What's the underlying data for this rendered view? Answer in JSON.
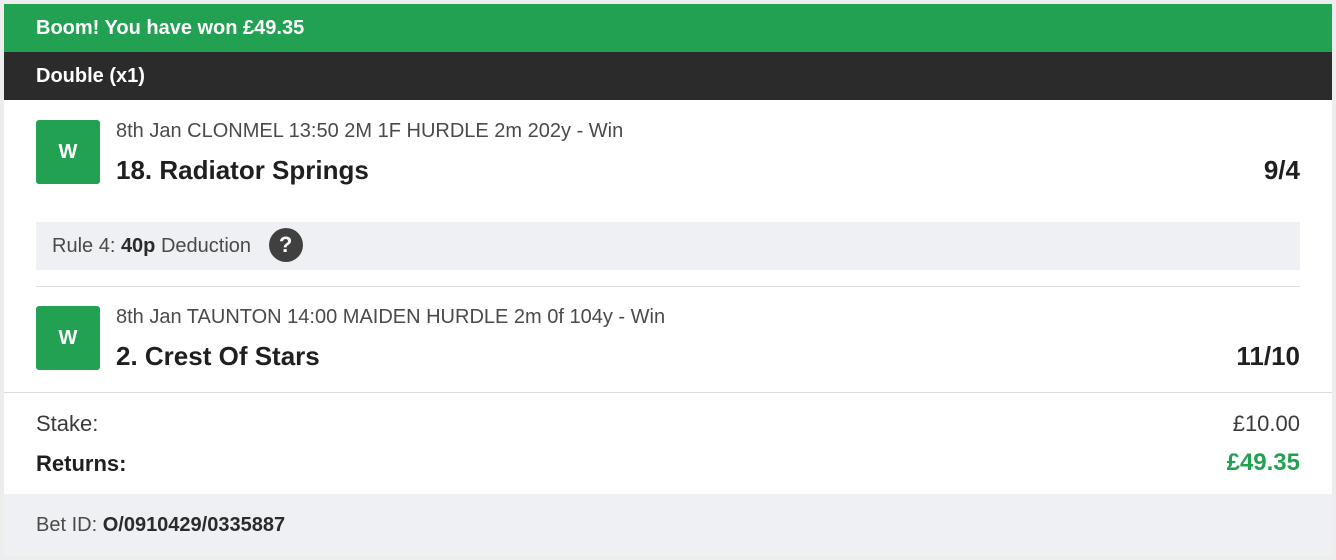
{
  "banner": {
    "message": "Boom! You have won £49.35"
  },
  "bet_type": {
    "label": "Double (x1)"
  },
  "selections": [
    {
      "badge": "W",
      "race_info": "8th Jan CLONMEL 13:50 2M 1F HURDLE 2m 202y - Win",
      "name": "18. Radiator Springs",
      "odds": "9/4"
    },
    {
      "badge": "W",
      "race_info": "8th Jan TAUNTON 14:00 MAIDEN HURDLE 2m 0f 104y - Win",
      "name": "2. Crest Of Stars",
      "odds": "11/10"
    }
  ],
  "rule4": {
    "prefix": "Rule 4:",
    "amount": "40p",
    "suffix": "Deduction",
    "help_icon": "?"
  },
  "summary": {
    "stake_label": "Stake:",
    "stake_value": "£10.00",
    "returns_label": "Returns:",
    "returns_value": "£49.35"
  },
  "bet_id": {
    "label": "Bet ID:",
    "value": "O/0910429/0335887"
  },
  "colors": {
    "win_green": "#22a152",
    "dark_bar": "#2b2b2b",
    "light_panel": "#eef0f3"
  }
}
